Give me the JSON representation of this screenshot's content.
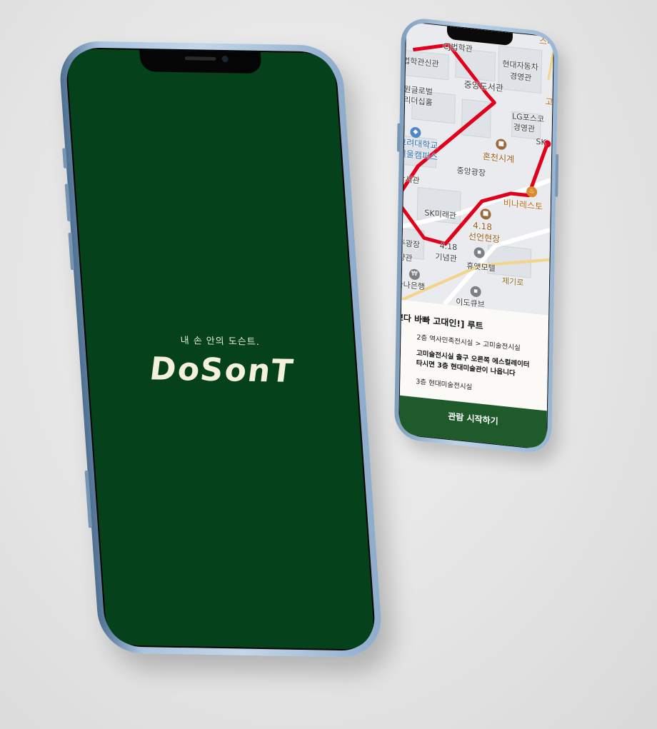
{
  "splash": {
    "tagline": "내 손 안의 도슨트.",
    "logo": "DoSonT"
  },
  "map": {
    "labels": {
      "cj": "CJ법학관",
      "law": "법학관신관",
      "hyundai_motor": "현대자동차",
      "mgmt": "경영관",
      "library": "중앙도서관",
      "global": "원글로벌",
      "leaders": "리더십홀",
      "lg": "LG포스코",
      "mgmt2": "경영관",
      "univ": "고려대학교",
      "seoul": "서울캠퍼스",
      "honcheon": "혼천시계",
      "plaza": "중앙광장",
      "hakseo": "학서관",
      "bina": "비나레스토",
      "sk": "SK미래관",
      "num418a": "4.18",
      "seon": "선언현장",
      "jugw": "주광장",
      "num418b": "4.18",
      "ginyeom": "기념관",
      "yanggwan": "양관",
      "hyuaet": "휴앳모텔",
      "jegiro": "제기로",
      "hana": "하나은행",
      "dokyub": "이도큐브",
      "sta": "스타",
      "sk2": "SK",
      "go": "고"
    },
    "route_color": "#e0001b"
  },
  "route_panel": {
    "title": "쁘다 바빠 고대인!] 루트",
    "step1": "2층  역사민족전시실 > 고미술전시실",
    "direction_line1": "고미술전시실 출구 오른쪽 에스컬레이터",
    "direction_line2": "타시면 3층 현대미술관이 나옵니다",
    "step2": "3층  현대미술전시실",
    "start_button": "관람 시작하기"
  },
  "colors": {
    "brand_green": "#05421b",
    "button_green": "#1f5a2a",
    "frame_blue": "#a9c4de"
  }
}
